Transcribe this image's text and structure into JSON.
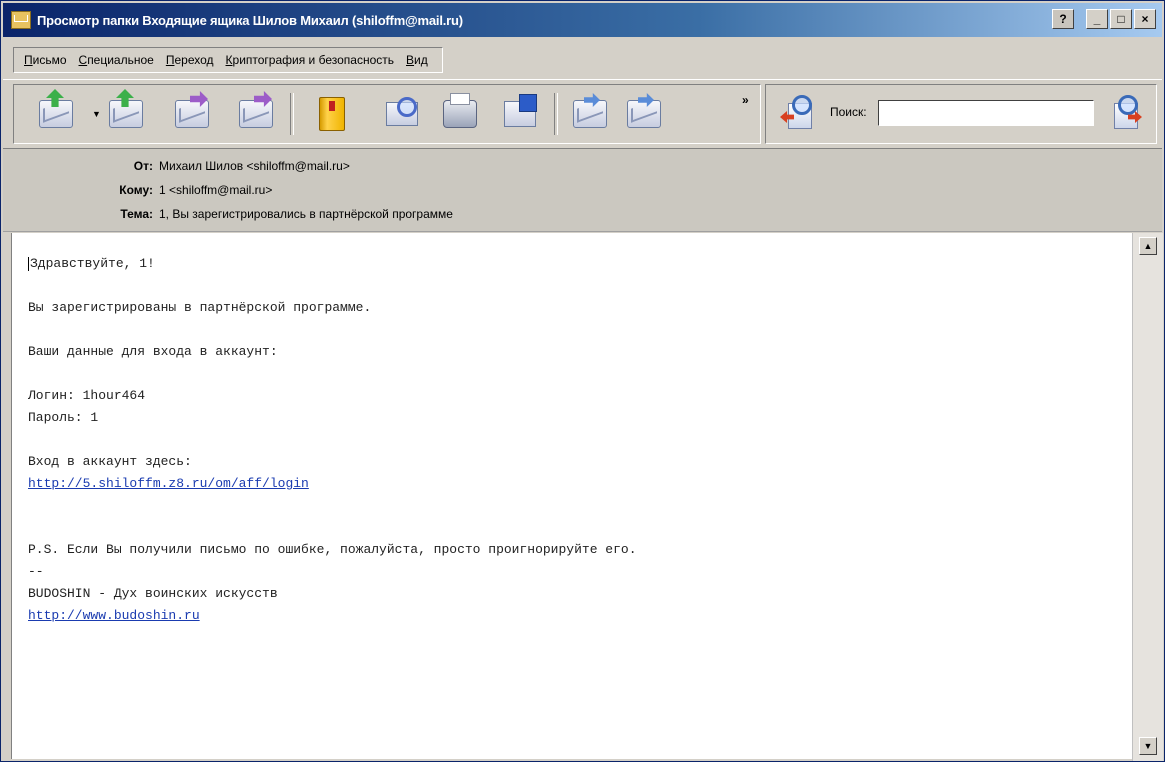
{
  "window": {
    "title": "Просмотр папки Входящие ящика Шилов Михаил (shiloffm@mail.ru)",
    "controls": {
      "help": "?",
      "minimize": "_",
      "maximize": "□",
      "close": "×"
    }
  },
  "menu": [
    {
      "first": "П",
      "rest": "исьмо"
    },
    {
      "first": "С",
      "rest": "пециальное"
    },
    {
      "first": "П",
      "rest": "ереход"
    },
    {
      "first": "К",
      "rest": "риптография и безопасность"
    },
    {
      "first": "В",
      "rest": "ид"
    }
  ],
  "toolbar": {
    "more": "»",
    "search_label": "Поиск:",
    "search_value": "",
    "icons": [
      "reply-icon",
      "reply-all-icon",
      "forward-icon",
      "forward-as-attachment-icon",
      "address-book-icon",
      "find-in-message-icon",
      "print-icon",
      "save-icon",
      "previous-message-icon",
      "next-message-icon"
    ]
  },
  "headers": {
    "from_label": "От:",
    "from_value": "Михаил Шилов <shiloffm@mail.ru>",
    "to_label": "Кому:",
    "to_value": "1 <shiloffm@mail.ru>",
    "subject_label": "Тема:",
    "subject_value": "1, Вы зарегистрировались в партнёрской программе"
  },
  "body": {
    "greeting": "Здравствуйте, 1!",
    "line1": "Вы зарегистрированы в партнёрской программе.",
    "line2": "Ваши данные для входа в аккаунт:",
    "login": "Логин: 1hour464",
    "password": "Пароль: 1",
    "login_here": "Вход в аккаунт здесь:",
    "login_link": "http://5.shiloffm.z8.ru/om/aff/login",
    "ps": "P.S. Если Вы получили письмо по ошибке, пожалуйста, просто проигнорируйте его.",
    "sig_sep": "--",
    "sig_name": "BUDOSHIN - Дух воинских искусств",
    "sig_link": "http://www.budoshin.ru"
  }
}
